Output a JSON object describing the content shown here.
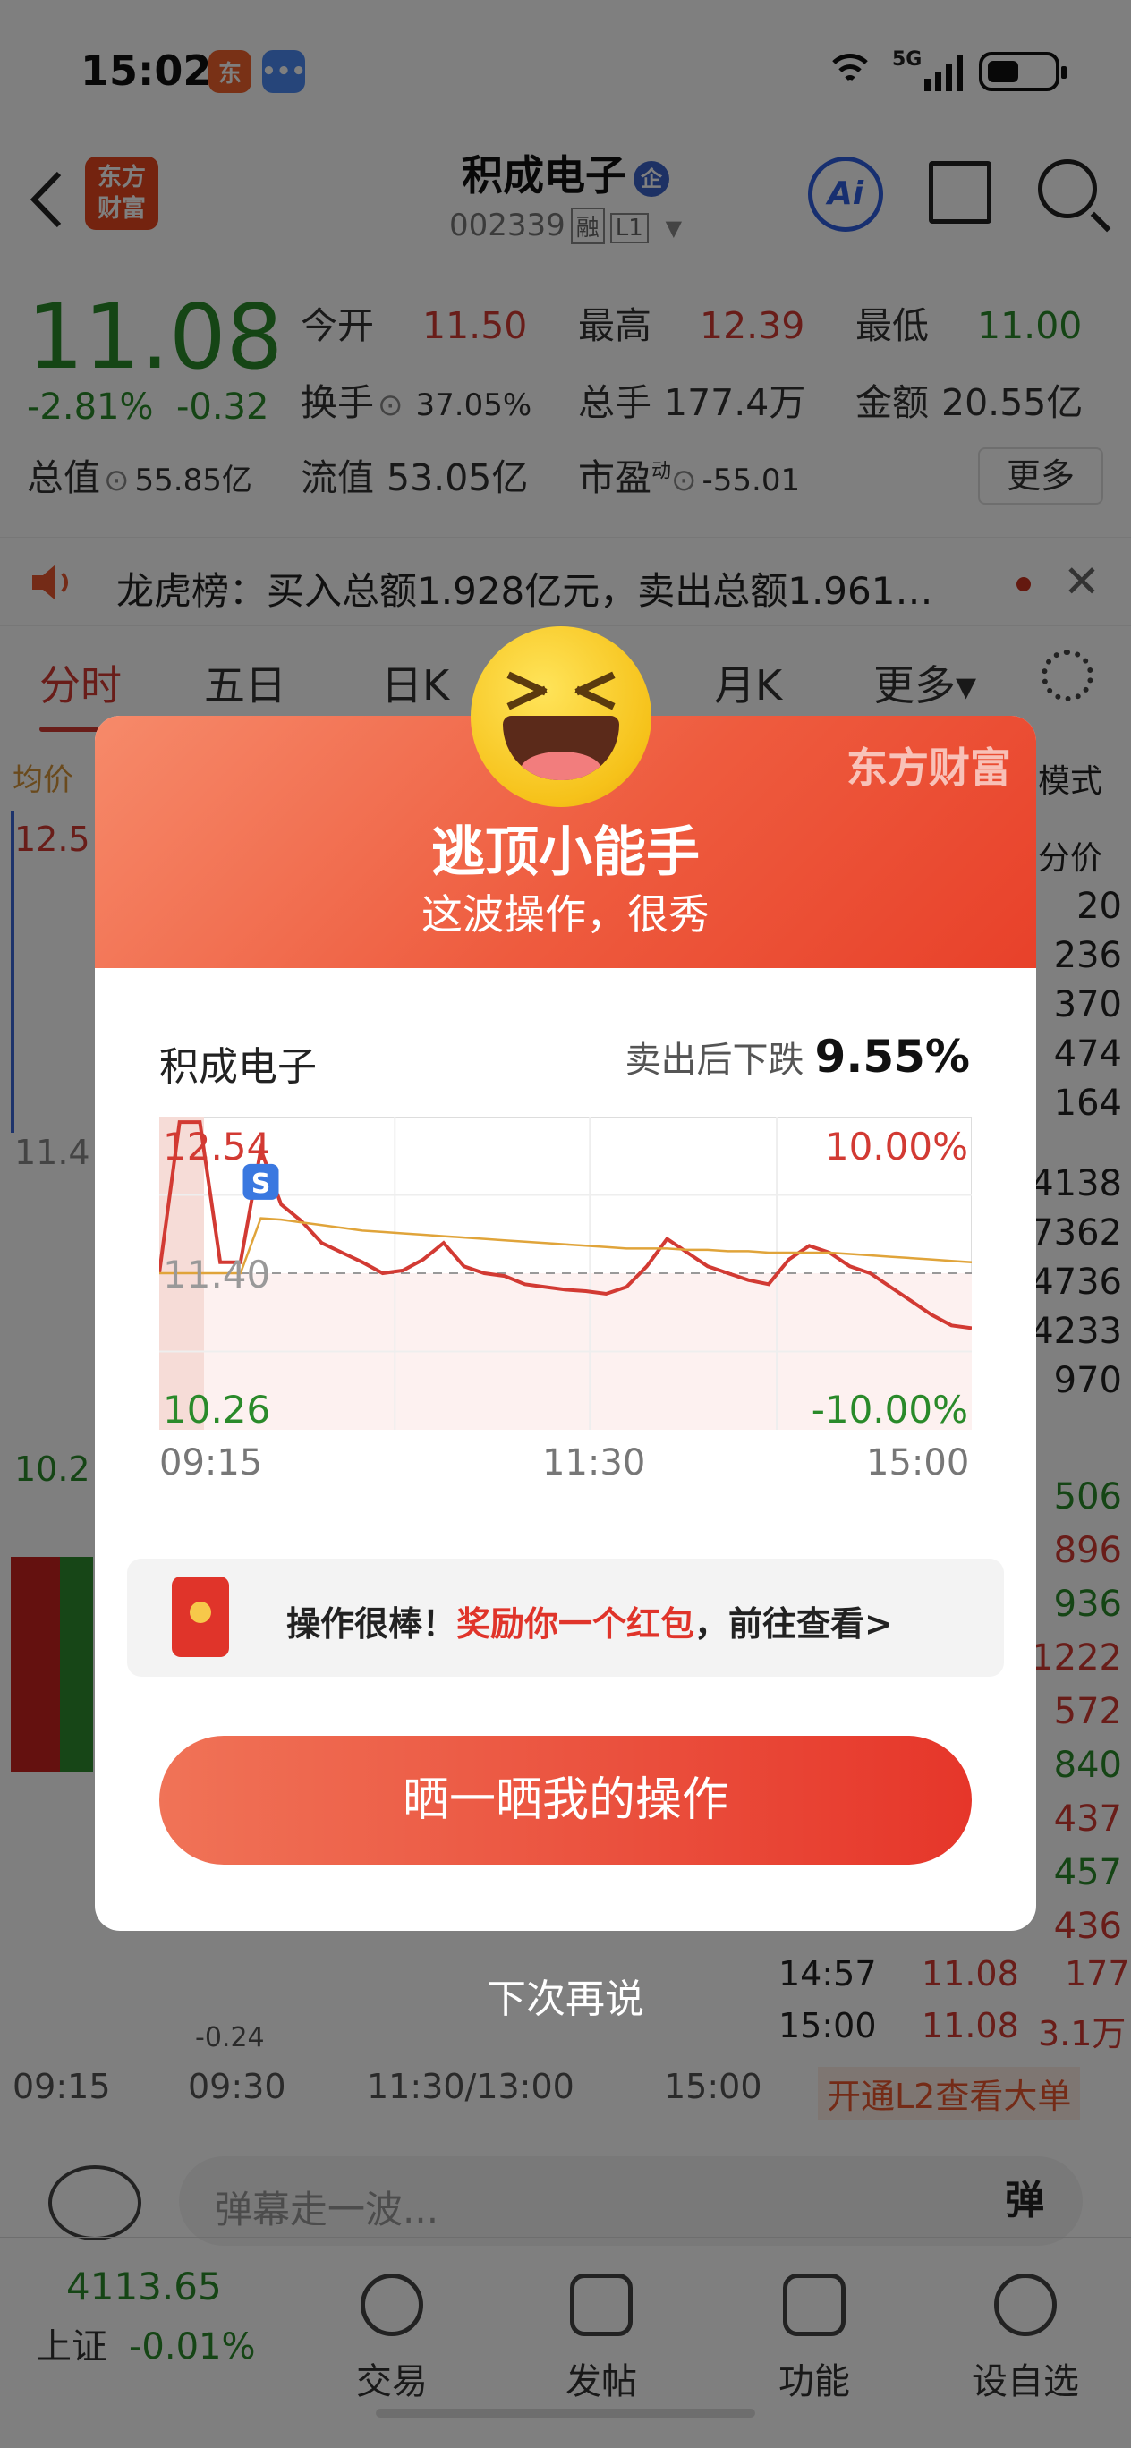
{
  "status": {
    "time": "15:02",
    "net": "5G",
    "orange_app": "东",
    "blue_app": "•••"
  },
  "header": {
    "logo_top": "东方",
    "logo_bottom": "财富",
    "title": "积成电子",
    "badge": "企",
    "code": "002339",
    "tag_rong": "融",
    "tag_l1": "L1",
    "ai": "Ai"
  },
  "quote": {
    "price": "11.08",
    "change_pct": "-2.81%",
    "change": "-0.32",
    "open_label": "今开",
    "open": "11.50",
    "high_label": "最高",
    "high": "12.39",
    "low_label": "最低",
    "low": "11.00",
    "turnover_label": "换手",
    "turnover": "37.05%",
    "volume_label": "总手",
    "volume": "177.4万",
    "amount_label": "金额",
    "amount": "20.55亿",
    "mcap_label": "总值",
    "mcap": "55.85亿",
    "float_label": "流值",
    "float": "53.05亿",
    "pe_label": "市盈",
    "pe_sup": "动",
    "pe": "-55.01",
    "more": "更多"
  },
  "notice": {
    "text": "龙虎榜：买入总额1.928亿元，卖出总额1.961…"
  },
  "tabs": [
    "分时",
    "五日",
    "日K",
    "月K",
    "更多▾"
  ],
  "background": {
    "avg_label": "均价",
    "mode_label": "模式",
    "fen_jia": "分价",
    "left_top": "12.5",
    "left_mid": "11.4",
    "left_bottom": "10.2",
    "small_value": "-0.24",
    "order_book": [
      "20",
      "236",
      "370",
      "474",
      "164",
      "4138",
      "7362",
      "4736",
      "4233",
      "970"
    ],
    "trades_vol": [
      "506",
      "896",
      "936",
      "1222",
      "572",
      "840",
      "437",
      "457",
      "436"
    ],
    "trade_rows": [
      {
        "time": "14:57",
        "price": "11.08",
        "vol": "177"
      },
      {
        "time": "15:00",
        "price": "11.08",
        "vol": "3.1万"
      }
    ],
    "x_labels": [
      "09:15",
      "09:30",
      "11:30/13:00",
      "15:00"
    ],
    "l2_promo": "开通L2查看大单"
  },
  "comment": {
    "placeholder": "弹幕走一波...",
    "button": "弹"
  },
  "bottom_nav": {
    "index_value": "4113.65",
    "index_name": "上证",
    "index_change": "-0.01%",
    "items": [
      "交易",
      "发帖",
      "功能",
      "设自选"
    ]
  },
  "modal": {
    "watermark": "东方财富",
    "title": "逃顶小能手",
    "subtitle": "这波操作，很秀",
    "stock": "积成电子",
    "drop_label": "卖出后下跌",
    "drop_pct": "9.55%",
    "reward_pre": "操作很棒！",
    "reward_highlight": "奖励你一个红包",
    "reward_post": "，前往查看>",
    "share_button": "晒一晒我的操作",
    "later": "下次再说",
    "sell_marker": "S"
  },
  "chart_data": {
    "type": "line",
    "title": "",
    "y_max_price": "12.54",
    "y_mid_price": "11.40",
    "y_min_price": "10.26",
    "y_max_pct": "10.00%",
    "y_min_pct": "-10.00%",
    "ylim": [
      10.26,
      12.54
    ],
    "x_ticks": [
      "09:15",
      "11:30",
      "15:00"
    ],
    "series": [
      {
        "color": "#d23a33",
        "values": [
          11.4,
          12.5,
          12.5,
          11.48,
          11.48,
          12.3,
          11.9,
          11.78,
          11.62,
          11.55,
          11.48,
          11.4,
          11.42,
          11.5,
          11.62,
          11.45,
          11.4,
          11.38,
          11.32,
          11.3,
          11.28,
          11.27,
          11.25,
          11.3,
          11.45,
          11.65,
          11.55,
          11.45,
          11.4,
          11.35,
          11.32,
          11.5,
          11.6,
          11.55,
          11.45,
          11.4,
          11.3,
          11.2,
          11.1,
          11.02,
          11.0
        ]
      },
      {
        "color": "#e0a43a",
        "values": [
          11.4,
          11.4,
          11.4,
          11.4,
          11.4,
          11.8,
          11.79,
          11.77,
          11.75,
          11.73,
          11.71,
          11.7,
          11.69,
          11.68,
          11.67,
          11.66,
          11.65,
          11.64,
          11.63,
          11.62,
          11.61,
          11.6,
          11.59,
          11.58,
          11.58,
          11.58,
          11.57,
          11.57,
          11.56,
          11.56,
          11.55,
          11.55,
          11.55,
          11.55,
          11.54,
          11.53,
          11.52,
          11.51,
          11.5,
          11.49,
          11.48
        ]
      }
    ],
    "reference": 11.4
  }
}
